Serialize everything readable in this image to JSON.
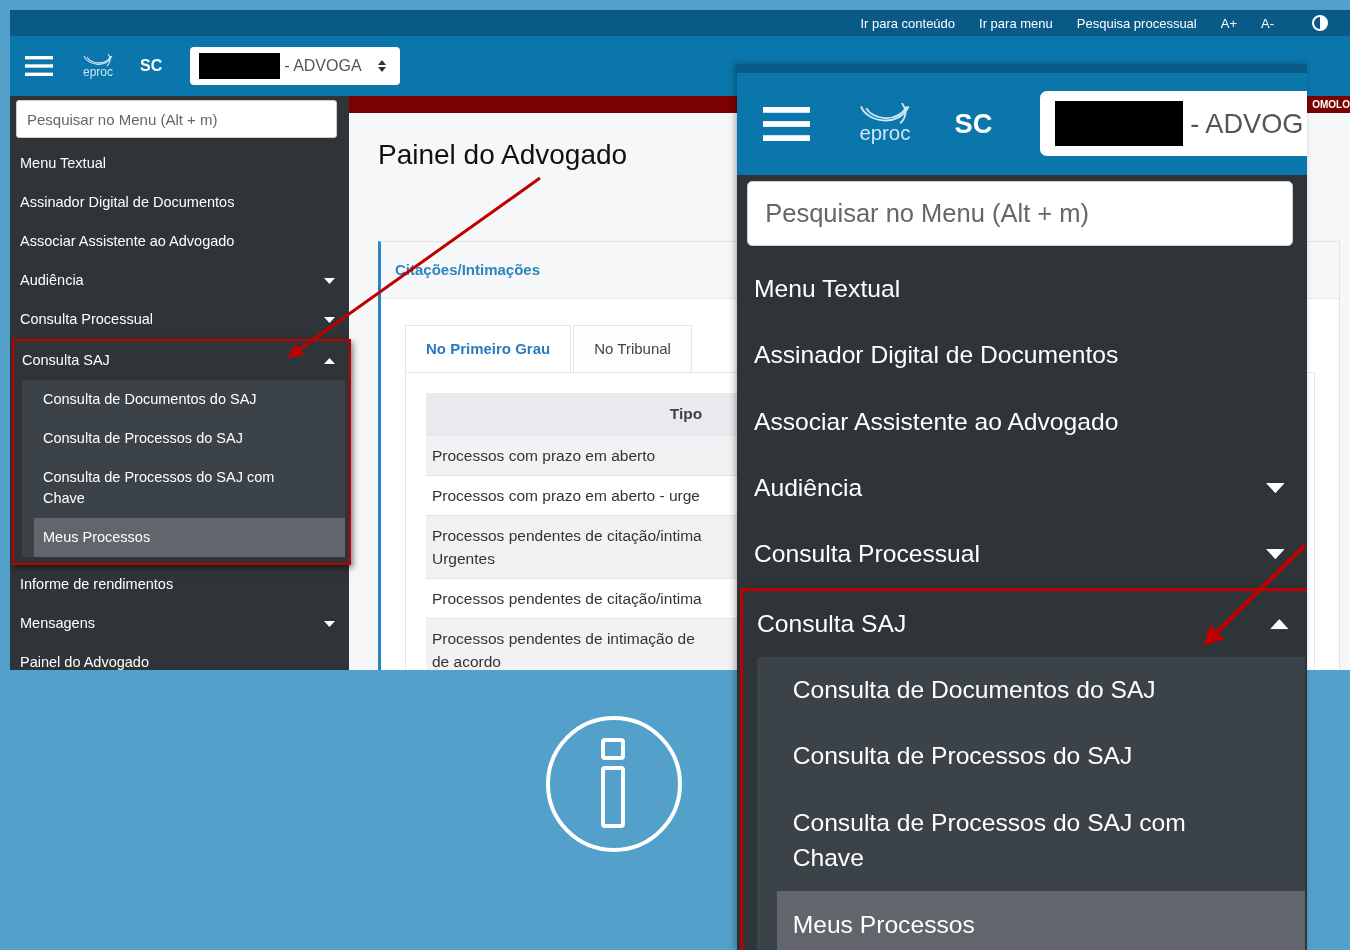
{
  "top_bar": {
    "links": [
      "Ir para conteúdo",
      "Ir para menu",
      "Pesquisa processual",
      "A+",
      "A-"
    ]
  },
  "header": {
    "logo_text": "eproc",
    "state": "SC",
    "profile_select": "- ADVOGA"
  },
  "sidebar": {
    "search": {
      "placeholder": "Pesquisar no Menu (Alt + m)"
    },
    "items": [
      {
        "label": "Menu Textual",
        "kind": "link"
      },
      {
        "label": "Assinador Digital de Documentos",
        "kind": "link"
      },
      {
        "label": "Associar Assistente ao Advogado",
        "kind": "link"
      },
      {
        "label": "Audiência",
        "kind": "group",
        "expanded": false
      },
      {
        "label": "Consulta Processual",
        "kind": "group",
        "expanded": false
      },
      {
        "label": "Consulta SAJ",
        "kind": "group",
        "expanded": true,
        "children": [
          {
            "label": "Consulta de Documentos do SAJ",
            "selected": false
          },
          {
            "label": "Consulta de Processos do SAJ",
            "selected": false
          },
          {
            "label": "Consulta de Processos do SAJ com Chave",
            "selected": false
          },
          {
            "label": "Meus Processos",
            "selected": true
          }
        ]
      },
      {
        "label": "Informe de rendimentos",
        "kind": "link"
      },
      {
        "label": "Mensagens",
        "kind": "group",
        "expanded": false
      },
      {
        "label": "Painel do Advogado",
        "kind": "link"
      }
    ]
  },
  "environment_banner": "OMOLO",
  "content": {
    "title": "Painel do Advogado",
    "panel": {
      "heading": "Citações/Intimações",
      "tabs": [
        {
          "label": "No Primeiro Grau",
          "selected": true
        },
        {
          "label": "No Tribunal",
          "selected": false
        }
      ],
      "table": {
        "columns": [
          "Tipo"
        ],
        "rows": [
          [
            "Processos com prazo em aberto"
          ],
          [
            "Processos com prazo em aberto - urge"
          ],
          [
            "Processos pendentes de citação/intima",
            "Urgentes"
          ],
          [
            "Processos pendentes de citação/intima"
          ],
          [
            "Processos pendentes de intimação de",
            "de acordo"
          ]
        ]
      }
    }
  },
  "zoom_inset": {
    "header": {
      "logo_text": "eproc",
      "state": "SC",
      "profile_select": "- ADVOG"
    },
    "sidebar": {
      "search": {
        "placeholder": "Pesquisar no Menu (Alt + m)"
      },
      "items": [
        {
          "label": "Menu Textual",
          "kind": "link"
        },
        {
          "label": "Assinador Digital de Documentos",
          "kind": "link"
        },
        {
          "label": "Associar Assistente ao Advogado",
          "kind": "link"
        },
        {
          "label": "Audiência",
          "kind": "group",
          "expanded": false
        },
        {
          "label": "Consulta Processual",
          "kind": "group",
          "expanded": false
        },
        {
          "label": "Consulta SAJ",
          "kind": "group",
          "expanded": true,
          "children": [
            {
              "label": "Consulta de Documentos do SAJ",
              "selected": false
            },
            {
              "label": "Consulta de Processos do SAJ",
              "selected": false
            },
            {
              "label": "Consulta de Processos do SAJ com Chave",
              "selected": false
            },
            {
              "label": "Meus Processos",
              "selected": true
            }
          ]
        }
      ]
    }
  }
}
